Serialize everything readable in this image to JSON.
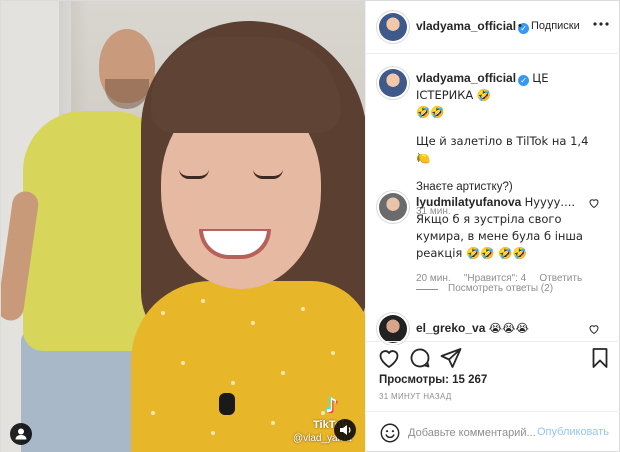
{
  "header": {
    "username": "vladyama_official",
    "separator": "•",
    "follow_label": "Подписки",
    "more_icon": "more-horizontal-icon"
  },
  "caption": {
    "username": "vladyama_official",
    "line1": "ЦЕ ІСТЕРИКА 🤣",
    "line1b": "🤣🤣",
    "line2": "Ще й залетіло в TilTok на 1,4🍋",
    "line3": "Знаєте артистку?)",
    "time": "31 мин."
  },
  "comments": [
    {
      "username": "lyudmilatyufanova",
      "text": "Нуууу.... Якщо б я зустріла свого кумира, в мене була б інша реакція 🤣🤣 🤣🤣",
      "time": "20 мин.",
      "likes": "\"Нравится\": 4",
      "reply_label": "Ответить",
      "replies_label": "Посмотреть ответы (2)"
    },
    {
      "username": "el_greko_va",
      "text": "😭😭😭"
    }
  ],
  "actions": {
    "views_label": "Просмотры: 15 267",
    "posted_ago": "31 МИНУТ НАЗАД"
  },
  "add_comment": {
    "placeholder": "Добавьте комментарий...",
    "publish_label": "Опубликовать"
  },
  "video": {
    "watermark_brand": "TikTok",
    "watermark_user": "@vlad_yama"
  },
  "colors": {
    "accent": "#3897f0",
    "text": "#262626",
    "muted": "#8e8e8e",
    "border": "#dbdbdb"
  }
}
